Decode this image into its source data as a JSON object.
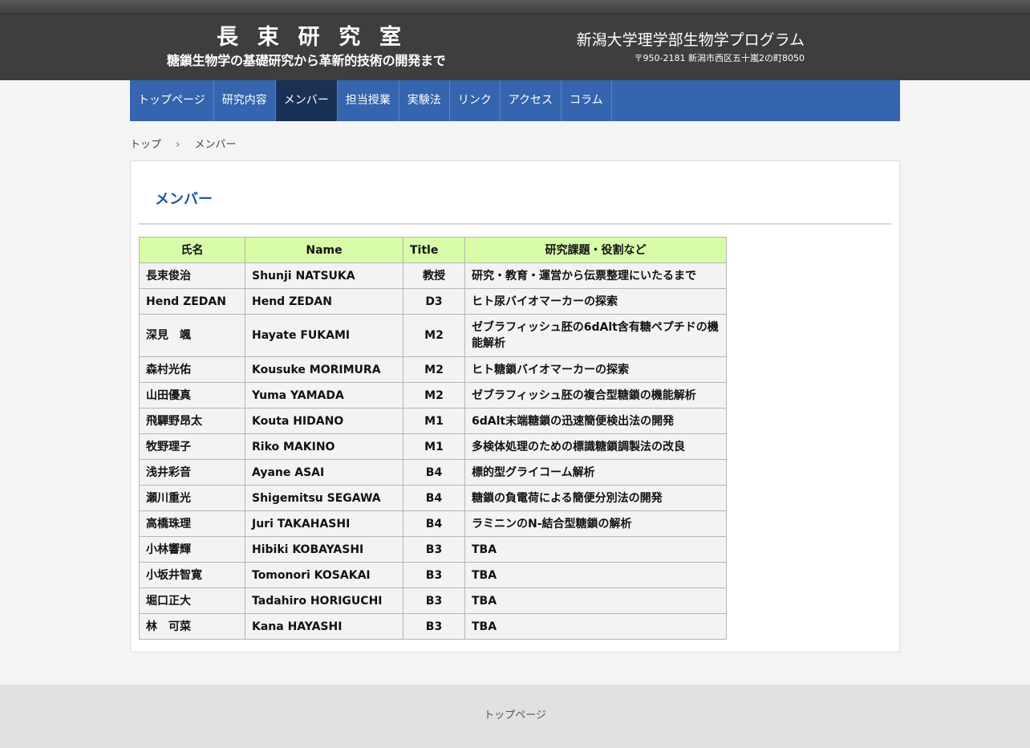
{
  "header": {
    "logo_title_chars": [
      "長",
      "束",
      "研",
      "究",
      "室"
    ],
    "logo_subtitle": "糖鎖生物学の基礎研究から革新的技術の開発まで",
    "org_name": "新潟大学理学部生物学プログラム",
    "org_address": "〒950-2181 新潟市西区五十嵐2の町8050"
  },
  "nav": {
    "items": [
      {
        "label": "トップページ",
        "active": false
      },
      {
        "label": "研究内容",
        "active": false
      },
      {
        "label": "メンバー",
        "active": true
      },
      {
        "label": "担当授業",
        "active": false
      },
      {
        "label": "実験法",
        "active": false
      },
      {
        "label": "リンク",
        "active": false
      },
      {
        "label": "アクセス",
        "active": false
      },
      {
        "label": "コラム",
        "active": false
      }
    ]
  },
  "breadcrumb": {
    "home": "トップ",
    "separator": "›",
    "current": "メンバー"
  },
  "main": {
    "page_title": "メンバー",
    "table": {
      "headers": [
        "氏名",
        "Name",
        "Title",
        "研究課題・役割など"
      ],
      "rows": [
        [
          "長束俊治",
          "Shunji NATSUKA",
          "教授",
          "研究・教育・運営から伝票整理にいたるまで"
        ],
        [
          "Hend ZEDAN",
          "Hend ZEDAN",
          "D3",
          "ヒト尿バイオマーカーの探索"
        ],
        [
          "深見　颯",
          "Hayate FUKAMI",
          "M2",
          "ゼブラフィッシュ胚の6dAlt含有糖ペプチドの機能解析"
        ],
        [
          "森村光佑",
          "Kousuke MORIMURA",
          "M2",
          "ヒト糖鎖バイオマーカーの探索"
        ],
        [
          "山田優真",
          "Yuma YAMADA",
          "M2",
          "ゼブラフィッシュ胚の複合型糖鎖の機能解析"
        ],
        [
          "飛驒野昂太",
          "Kouta HIDANO",
          "M1",
          "6dAlt末端糖鎖の迅速簡便検出法の開発"
        ],
        [
          "牧野理子",
          "Riko MAKINO",
          "M1",
          "多検体処理のための標識糖鎖調製法の改良"
        ],
        [
          "浅井彩音",
          "Ayane ASAI",
          "B4",
          "標的型グライコーム解析"
        ],
        [
          "瀬川重光",
          "Shigemitsu SEGAWA",
          "B4",
          "糖鎖の負電荷による簡便分別法の開発"
        ],
        [
          "高橋珠理",
          "Juri TAKAHASHI",
          "B4",
          "ラミニンのN-結合型糖鎖の解析"
        ],
        [
          "小林響輝",
          "Hibiki KOBAYASHI",
          "B3",
          "TBA"
        ],
        [
          "小坂井智寛",
          "Tomonori KOSAKAI",
          "B3",
          "TBA"
        ],
        [
          "堀口正大",
          "Tadahiro HORIGUCHI",
          "B3",
          "TBA"
        ],
        [
          "林　可菜",
          "Kana HAYASHI",
          "B3",
          "TBA"
        ]
      ]
    }
  },
  "footer": {
    "link": "トップページ"
  },
  "colors": {
    "header_bg": "#3e3e3e",
    "nav_bg": "#3465ae",
    "nav_active_bg": "#1a3157",
    "title_color": "#1e56a6",
    "table_header_bg": "#d8fca8",
    "table_cell_bg": "#f3f3f3",
    "footer_bg": "#e1e1e1"
  }
}
